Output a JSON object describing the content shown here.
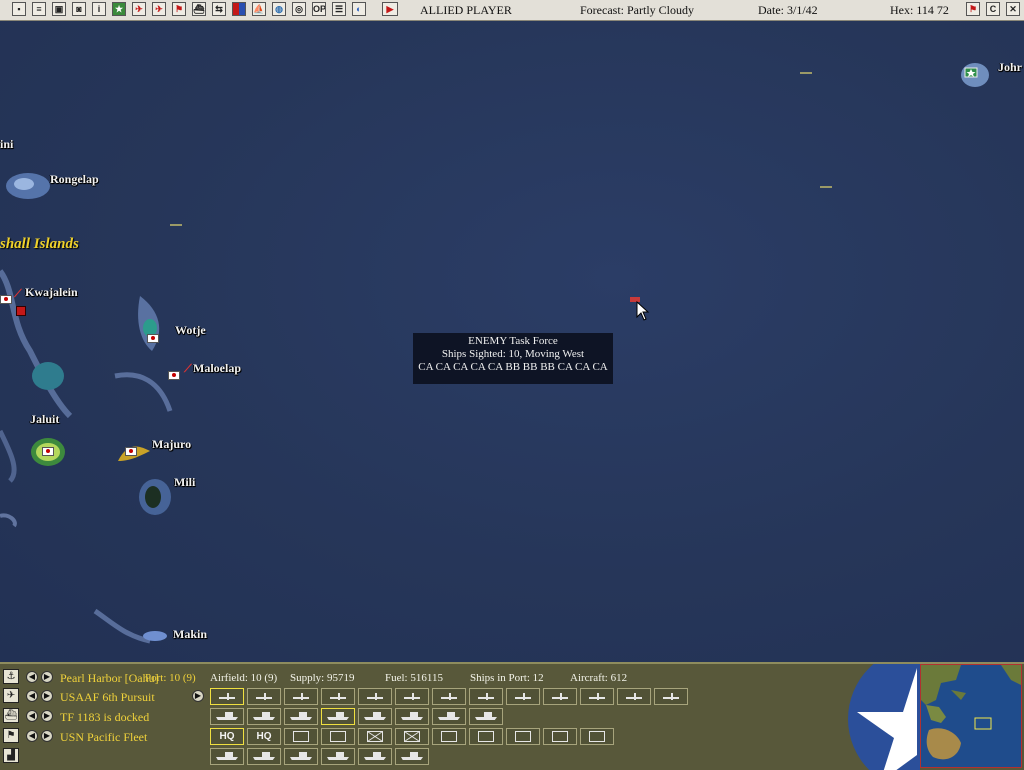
{
  "top_bar": {
    "player": "ALLIED PLAYER",
    "forecast": "Forecast: Partly Cloudy",
    "date": "Date: 3/1/42",
    "hex": "Hex: 114  72",
    "buttons": [
      {
        "name": "save-icon",
        "glyph": "▪"
      },
      {
        "name": "report-icon",
        "glyph": "≡"
      },
      {
        "name": "base-report-icon",
        "glyph": "▣"
      },
      {
        "name": "ship-report-icon",
        "glyph": "◙"
      },
      {
        "name": "info-icon",
        "glyph": "i"
      },
      {
        "name": "star-icon",
        "glyph": "★"
      },
      {
        "name": "plane-red-icon",
        "glyph": "✈"
      },
      {
        "name": "plane-blue-icon",
        "glyph": "✈"
      },
      {
        "name": "flag-icon",
        "glyph": "⚑"
      },
      {
        "name": "ship-icon",
        "glyph": "⛴"
      },
      {
        "name": "convoy-icon",
        "glyph": "⇆"
      },
      {
        "name": "color-grid-icon",
        "glyph": "▦"
      },
      {
        "name": "fleet-icon",
        "glyph": "⛵"
      },
      {
        "name": "globe-icon",
        "glyph": "◍"
      },
      {
        "name": "target-icon",
        "glyph": "◎"
      },
      {
        "name": "op-icon",
        "glyph": "OP"
      },
      {
        "name": "list-icon",
        "glyph": "☰"
      },
      {
        "name": "camera-icon",
        "glyph": "◐"
      },
      {
        "name": "end-turn-icon",
        "glyph": "▶"
      }
    ],
    "right_buttons": [
      {
        "name": "flag-toggle-icon",
        "glyph": "⚑"
      },
      {
        "name": "c-icon",
        "glyph": "C"
      },
      {
        "name": "close-icon",
        "glyph": "✕"
      }
    ]
  },
  "map": {
    "region": "shall Islands",
    "locations": {
      "bikini": "ini",
      "rongelap": "Rongelap",
      "kwajalein": "Kwajalein",
      "wotje": "Wotje",
      "maloelap": "Maloelap",
      "jaluit": "Jaluit",
      "majuro": "Majuro",
      "mili": "Mili",
      "makin": "Makin",
      "johnston": "Johr"
    },
    "tooltip": {
      "title": "ENEMY Task Force",
      "line2": "Ships Sighted: 10, Moving West",
      "line3": "CA CA CA CA CA BB BB BB CA CA CA"
    }
  },
  "bottom": {
    "base": "Pearl Harbor [Oahu]",
    "port": "Port: 10 (9)",
    "airfield": "Airfield: 10 (9)",
    "supply": "Supply: 95719",
    "fuel": "Fuel: 516115",
    "ships_in_port": "Ships in Port: 12",
    "aircraft": "Aircraft: 612",
    "air_group": "USAAF 6th Pursuit",
    "task_force": "TF 1183 is docked",
    "command": "USN Pacific Fleet",
    "hq_label": "HQ"
  }
}
